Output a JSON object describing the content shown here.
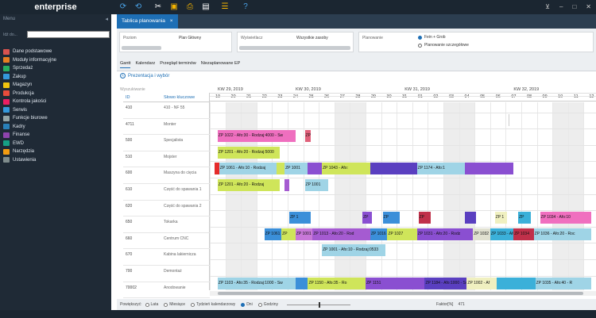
{
  "app": {
    "title": "enterprise"
  },
  "colors": {
    "topbar": "#1b2631",
    "sidebar": "#1f2a36",
    "accent": "#1e6fb5"
  },
  "toolbar": {
    "icons": [
      "refresh-icon",
      "sync-icon",
      "tools-icon",
      "briefcase-icon",
      "printer-icon",
      "export-icon",
      "hierarchy-icon",
      "help-icon"
    ]
  },
  "sidebar": {
    "title": "Menu",
    "search_label": "Idź do...",
    "items": [
      {
        "label": "Dane podstawowe",
        "color": "#d9534f"
      },
      {
        "label": "Moduły informacyjne",
        "color": "#e67e22"
      },
      {
        "label": "Sprzedaż",
        "color": "#27ae60"
      },
      {
        "label": "Zakup",
        "color": "#3498db"
      },
      {
        "label": "Magazyn",
        "color": "#f1c40f"
      },
      {
        "label": "Produkcja",
        "color": "#e74c3c"
      },
      {
        "label": "Kontrola jakości",
        "color": "#e91e63"
      },
      {
        "label": "Serwis",
        "color": "#3498db"
      },
      {
        "label": "Funkcje biurowe",
        "color": "#95a5a6"
      },
      {
        "label": "Kadry",
        "color": "#2980b9"
      },
      {
        "label": "Finanse",
        "color": "#8e44ad"
      },
      {
        "label": "EWD",
        "color": "#16a085"
      },
      {
        "label": "Narzędzia",
        "color": "#f39c12"
      },
      {
        "label": "Ustawienia",
        "color": "#7f8c8d"
      }
    ]
  },
  "doc_tab": {
    "label": "Tablica planowania",
    "close": "×"
  },
  "filters": {
    "poziom_label": "Poziom",
    "poziom_value": "Plan Główny",
    "wyswietlacz_label": "Wyświetlacz",
    "wyswietlacz_value": "Wszystkie zasoby",
    "planowanie_label": "Planowanie",
    "planowanie_opt1": "Fein + Grob",
    "planowanie_opt2": "Planowanie szczegółowe"
  },
  "view_tabs": [
    "Gantt",
    "Kalendarz",
    "Przegląd terminów",
    "Niezaplanowane EP"
  ],
  "section": {
    "label": "Prezentacja i wybór"
  },
  "search_hint": "Wyszukiwanie",
  "grid": {
    "col_id": "ID",
    "col_kw": "Słowo kluczowe",
    "rows": [
      {
        "id": "410",
        "kw": "410 - NF 55"
      },
      {
        "id": "4711",
        "kw": "Monter"
      },
      {
        "id": "500",
        "kw": "Specjalista"
      },
      {
        "id": "510",
        "kw": "Mojster"
      },
      {
        "id": "600",
        "kw": "Maszyna do cięcia"
      },
      {
        "id": "610",
        "kw": "Część do spawania 1"
      },
      {
        "id": "620",
        "kw": "Część do spawania 2"
      },
      {
        "id": "650",
        "kw": "Tokarka"
      },
      {
        "id": "660",
        "kw": "Centrum CNC"
      },
      {
        "id": "670",
        "kw": "Kabina lakiernicza"
      },
      {
        "id": "700",
        "kw": "Demontaż"
      },
      {
        "id": "70002",
        "kw": "Anodowanie"
      }
    ]
  },
  "timeline": {
    "weeks": [
      {
        "label": "KW 29, 2019",
        "day": 0
      },
      {
        "label": "KW 30, 2019",
        "day": 5
      },
      {
        "label": "KW 31, 2019",
        "day": 12
      },
      {
        "label": "KW 32, 2019",
        "day": 19
      }
    ],
    "days": [
      "19",
      "20",
      "21",
      "22",
      "23",
      "24",
      "25",
      "26",
      "27",
      "28",
      "29",
      "30",
      "31",
      "01",
      "02",
      "03",
      "04",
      "05",
      "06",
      "07",
      "08",
      "09",
      "10",
      "11",
      "12"
    ],
    "weekend_days": [
      1,
      2,
      8,
      9,
      15,
      16,
      22,
      23
    ]
  },
  "chart_data": {
    "type": "gantt",
    "bars": [
      {
        "row": 1,
        "start": 19.2,
        "end": 19.25,
        "color": "#cccccc",
        "label": ""
      },
      {
        "row": 2,
        "start": 0.5,
        "end": 5.5,
        "color": "#ef6fbf",
        "label": "ZP 1022 - Afo:30 - Rodzaj:4000 - Sw"
      },
      {
        "row": 2,
        "start": 6.1,
        "end": 6.5,
        "color": "#e0607a",
        "label": "ZP"
      },
      {
        "row": 3,
        "start": 0.5,
        "end": 4.5,
        "color": "#cfe55a",
        "label": "ZP 1201 - Afo:20 - Rodzaj:5000"
      },
      {
        "row": 4,
        "start": 0.3,
        "end": 0.6,
        "color": "#e52b2b",
        "label": ""
      },
      {
        "row": 4,
        "start": 0.6,
        "end": 4.3,
        "color": "#9fd4e6",
        "label": "ZP 1061 - Afo:10 - Rodzaj"
      },
      {
        "row": 4,
        "start": 4.3,
        "end": 4.8,
        "color": "#cfe55a",
        "label": ""
      },
      {
        "row": 4,
        "start": 4.8,
        "end": 6.3,
        "color": "#9fd4e6",
        "label": "ZP 1001"
      },
      {
        "row": 4,
        "start": 6.3,
        "end": 7.2,
        "color": "#8a4fd1",
        "label": ""
      },
      {
        "row": 4,
        "start": 7.2,
        "end": 10.3,
        "color": "#cfe55a",
        "label": "ZP 1043 - Afo:"
      },
      {
        "row": 4,
        "start": 10.3,
        "end": 13.3,
        "color": "#5a3fc0",
        "label": ""
      },
      {
        "row": 4,
        "start": 13.3,
        "end": 16.4,
        "color": "#9fd4e6",
        "label": "ZP 1174 - Afo:1"
      },
      {
        "row": 4,
        "start": 16.4,
        "end": 19.5,
        "color": "#8a4fd1",
        "label": ""
      },
      {
        "row": 5,
        "start": 0.5,
        "end": 4.5,
        "color": "#cfe55a",
        "label": "ZP 1201 - Afo:20 - Rodzaj"
      },
      {
        "row": 5,
        "start": 4.8,
        "end": 5.1,
        "color": "#a55bd1",
        "label": ""
      },
      {
        "row": 5,
        "start": 6.1,
        "end": 7.6,
        "color": "#9fd4e6",
        "label": "ZP 1001"
      },
      {
        "row": 7,
        "start": 5.1,
        "end": 6.5,
        "color": "#3b8fd9",
        "label": "ZP 1"
      },
      {
        "row": 7,
        "start": 9.8,
        "end": 10.4,
        "color": "#8a4fd1",
        "label": "ZP"
      },
      {
        "row": 7,
        "start": 11.1,
        "end": 12.2,
        "color": "#3b8fd9",
        "label": "ZP"
      },
      {
        "row": 7,
        "start": 13.4,
        "end": 14.2,
        "color": "#c0304a",
        "label": "ZP"
      },
      {
        "row": 7,
        "start": 16.4,
        "end": 17.1,
        "color": "#5a3fc0",
        "label": ""
      },
      {
        "row": 7,
        "start": 18.3,
        "end": 19.1,
        "color": "#f0f0c0",
        "label": "ZP 1"
      },
      {
        "row": 7,
        "start": 19.8,
        "end": 20.6,
        "color": "#3bb0d9",
        "label": "ZP"
      },
      {
        "row": 7,
        "start": 21.2,
        "end": 24.5,
        "color": "#f06fbf",
        "label": "ZP 1034 - Afo:10"
      },
      {
        "row": 8,
        "start": 3.5,
        "end": 4.6,
        "color": "#3b8fd9",
        "label": "ZP 1061"
      },
      {
        "row": 8,
        "start": 4.6,
        "end": 5.5,
        "color": "#cfe55a",
        "label": "ZP"
      },
      {
        "row": 8,
        "start": 5.5,
        "end": 6.6,
        "color": "#c878d9",
        "label": "ZP 1001"
      },
      {
        "row": 8,
        "start": 6.6,
        "end": 10.3,
        "color": "#a55bd1",
        "label": "ZP 1013 - Afo:20 - Rod"
      },
      {
        "row": 8,
        "start": 10.3,
        "end": 11.4,
        "color": "#3b8fd9",
        "label": "ZP 1016"
      },
      {
        "row": 8,
        "start": 11.4,
        "end": 13.3,
        "color": "#cfe55a",
        "label": "ZP 1027"
      },
      {
        "row": 8,
        "start": 13.3,
        "end": 16.9,
        "color": "#8a4fd1",
        "label": "ZP 1031 - Afo:20 - Rodz"
      },
      {
        "row": 8,
        "start": 16.9,
        "end": 18.0,
        "color": "#e0e0d0",
        "label": "ZP 1032"
      },
      {
        "row": 8,
        "start": 18.0,
        "end": 19.5,
        "color": "#3bb0d9",
        "label": "ZP 1033 - Afo:"
      },
      {
        "row": 8,
        "start": 19.5,
        "end": 20.8,
        "color": "#c0304a",
        "label": "ZP 1034"
      },
      {
        "row": 8,
        "start": 20.8,
        "end": 24.5,
        "color": "#9fd4e6",
        "label": "ZP 1036 - Afo:20 - Roc"
      },
      {
        "row": 9,
        "start": 7.2,
        "end": 11.3,
        "color": "#9fd4e6",
        "label": "ZP 1001 - Afo:10 - Rodzaj:0533"
      },
      {
        "row": 11,
        "start": 0.5,
        "end": 5.5,
        "color": "#9fd4e6",
        "label": "ZP 1103 - Afo:35 - Rodzaj:1000 - Sw"
      },
      {
        "row": 11,
        "start": 5.5,
        "end": 6.3,
        "color": "#3b8fd9",
        "label": ""
      },
      {
        "row": 11,
        "start": 6.3,
        "end": 10.0,
        "color": "#cfe55a",
        "label": "ZP 1150 - Afo:35 - Ro"
      },
      {
        "row": 11,
        "start": 10.0,
        "end": 13.8,
        "color": "#8a4fd1",
        "label": "ZP 1151"
      },
      {
        "row": 11,
        "start": 13.8,
        "end": 16.5,
        "color": "#5a3fc0",
        "label": "ZP 1184 - Afo:1000 - Sw"
      },
      {
        "row": 11,
        "start": 16.5,
        "end": 18.4,
        "color": "#f0f0c0",
        "label": "ZP 1002 - Af"
      },
      {
        "row": 11,
        "start": 18.4,
        "end": 20.9,
        "color": "#3bb0d9",
        "label": ""
      },
      {
        "row": 11,
        "start": 20.9,
        "end": 24.5,
        "color": "#9fd4e6",
        "label": "ZP 1035 - Afo:40 - R"
      }
    ]
  },
  "bottom": {
    "label": "Powiększyć:",
    "options": [
      "Lata",
      "Miesiące",
      "Tydzień kalendarzowy",
      "Dni",
      "Godziny"
    ],
    "selected": 3,
    "factor_label": "Faktor[%]",
    "factor_value": "471"
  }
}
